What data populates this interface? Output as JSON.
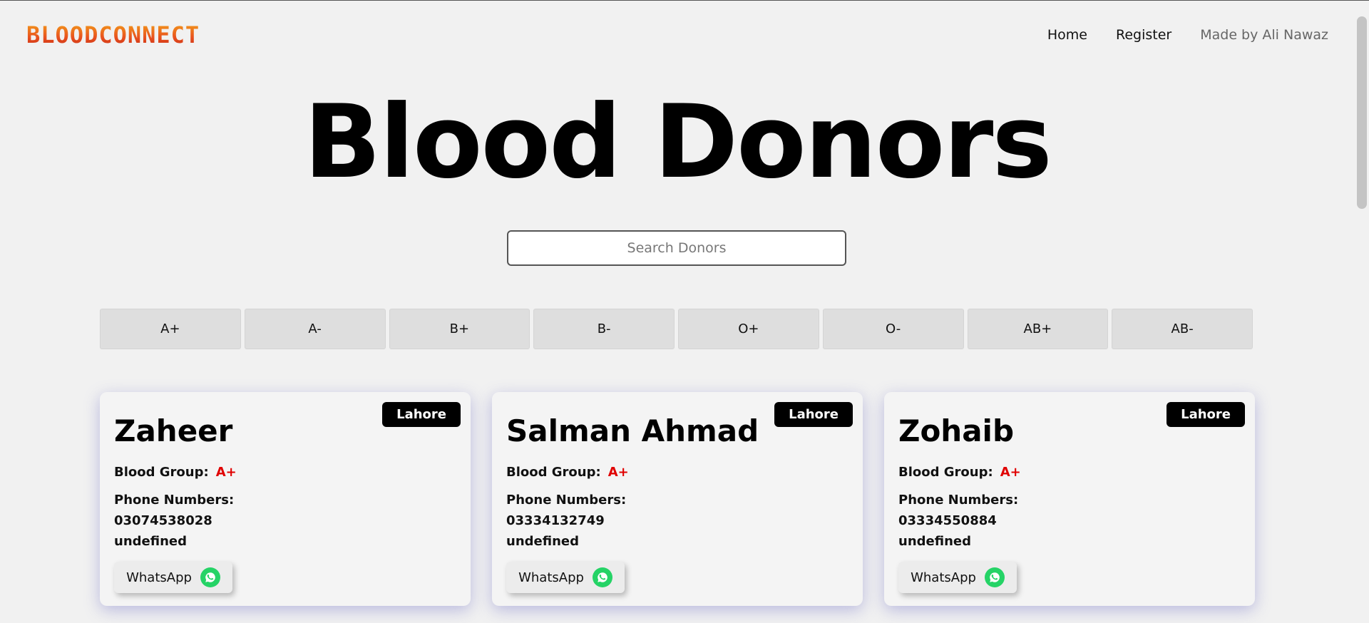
{
  "nav": {
    "logo": "BLOODCONNECT",
    "links": [
      "Home",
      "Register"
    ],
    "credit": "Made by Ali Nawaz"
  },
  "hero": {
    "title": "Blood Donors"
  },
  "search": {
    "placeholder": "Search Donors"
  },
  "filters": [
    "A+",
    "A-",
    "B+",
    "B-",
    "O+",
    "O-",
    "AB+",
    "AB-"
  ],
  "cards": [
    {
      "city": "Lahore",
      "name": "Zaheer",
      "blood_label": "Blood Group:",
      "blood_group": "A+",
      "phone_label": "Phone Numbers:",
      "phones": [
        "03074538028",
        "undefined"
      ],
      "whatsapp": "WhatsApp"
    },
    {
      "city": "Lahore",
      "name": "Salman Ahmad",
      "blood_label": "Blood Group:",
      "blood_group": "A+",
      "phone_label": "Phone Numbers:",
      "phones": [
        "03334132749",
        "undefined"
      ],
      "whatsapp": "WhatsApp"
    },
    {
      "city": "Lahore",
      "name": "Zohaib",
      "blood_label": "Blood Group:",
      "blood_group": "A+",
      "phone_label": "Phone Numbers:",
      "phones": [
        "03334550884",
        "undefined"
      ],
      "whatsapp": "WhatsApp"
    }
  ],
  "colors": {
    "accent": "#e00000",
    "whatsapp": "#25d366",
    "logo": "#e8491f"
  },
  "icons": {
    "whatsapp": "whatsapp-icon"
  }
}
